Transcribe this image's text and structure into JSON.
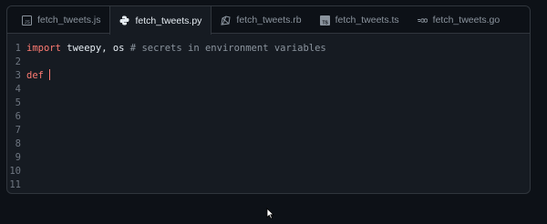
{
  "tabs": [
    {
      "label": "fetch_tweets.js",
      "icon": "javascript-icon",
      "active": false
    },
    {
      "label": "fetch_tweets.py",
      "icon": "python-icon",
      "active": true
    },
    {
      "label": "fetch_tweets.rb",
      "icon": "ruby-icon",
      "active": false
    },
    {
      "label": "fetch_tweets.ts",
      "icon": "typescript-icon",
      "active": false
    },
    {
      "label": "fetch_tweets.go",
      "icon": "go-icon",
      "active": false
    }
  ],
  "editor": {
    "line_numbers": [
      "1",
      "2",
      "3",
      "4",
      "5",
      "6",
      "7",
      "8",
      "9",
      "10",
      "11"
    ],
    "line1": {
      "keyword": "import",
      "code": " tweepy, os ",
      "comment": "# secrets in environment variables"
    },
    "line3": {
      "keyword": "def"
    }
  },
  "colors": {
    "background": "#0d1117",
    "editor_bg": "#161b22",
    "keyword": "#ff7b72",
    "comment": "#8b949e",
    "line_number": "#6e7681"
  }
}
